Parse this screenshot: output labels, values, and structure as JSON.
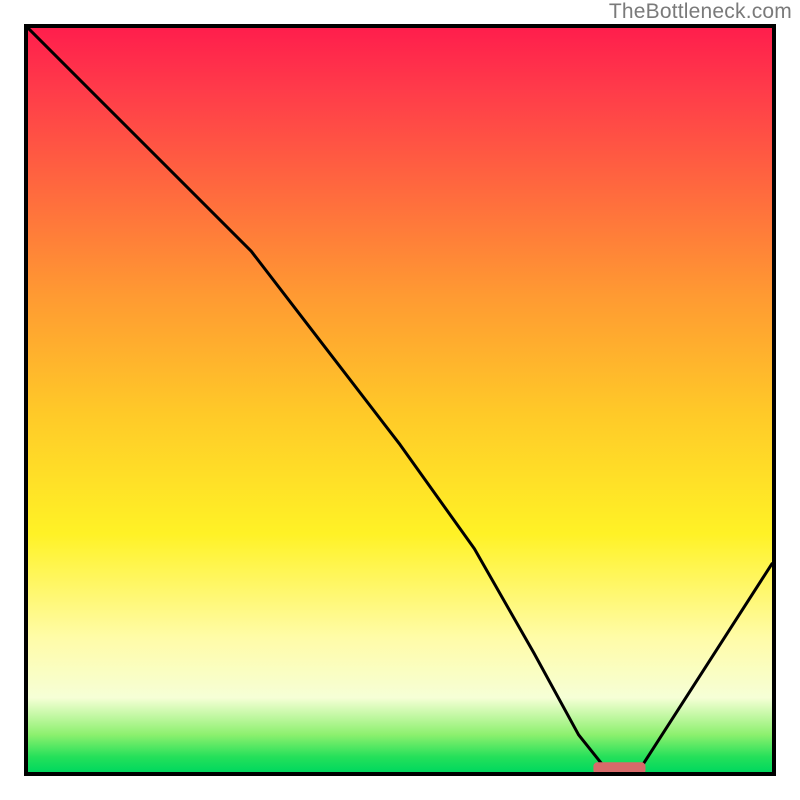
{
  "watermark": "TheBottleneck.com",
  "chart_data": {
    "type": "line",
    "title": "",
    "xlabel": "",
    "ylabel": "",
    "xlim": [
      0,
      100
    ],
    "ylim": [
      0,
      100
    ],
    "grid": false,
    "legend": false,
    "series": [
      {
        "name": "bottleneck-curve",
        "x": [
          0,
          10,
          22,
          30,
          40,
          50,
          60,
          68,
          74,
          78,
          82,
          100
        ],
        "y": [
          100,
          90,
          78,
          70,
          57,
          44,
          30,
          16,
          5,
          0,
          0,
          28
        ]
      }
    ],
    "marker": {
      "name": "optimal-segment",
      "x_range": [
        76,
        83
      ],
      "y": 0.5,
      "color": "#d86a6a"
    },
    "background_gradient": {
      "orientation": "vertical",
      "stops": [
        {
          "pct": 0,
          "color": "#ff1e4c"
        },
        {
          "pct": 8,
          "color": "#ff3a4a"
        },
        {
          "pct": 22,
          "color": "#ff6a3e"
        },
        {
          "pct": 36,
          "color": "#ff9a32"
        },
        {
          "pct": 52,
          "color": "#ffca28"
        },
        {
          "pct": 68,
          "color": "#fff226"
        },
        {
          "pct": 82,
          "color": "#fffca8"
        },
        {
          "pct": 90,
          "color": "#f6ffd6"
        },
        {
          "pct": 95,
          "color": "#8cf06e"
        },
        {
          "pct": 98,
          "color": "#24e05a"
        },
        {
          "pct": 100,
          "color": "#00d85e"
        }
      ]
    }
  }
}
